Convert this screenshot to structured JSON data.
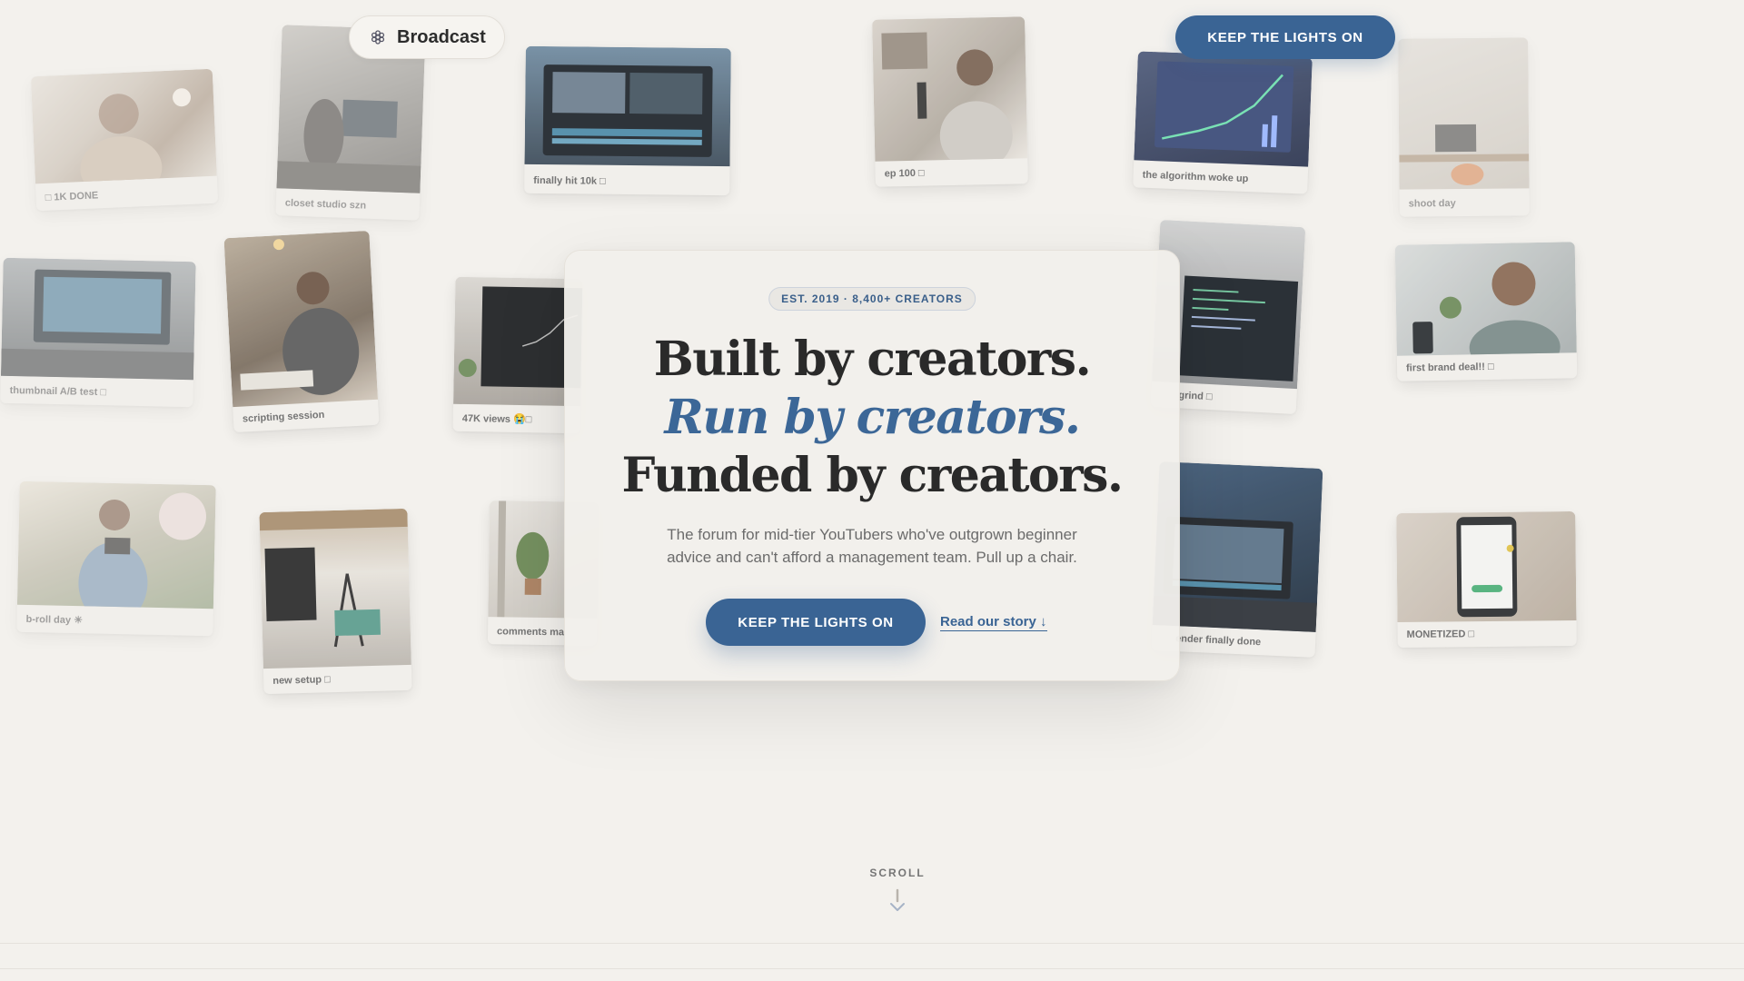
{
  "brand": {
    "name": "Broadcast",
    "logo_icon": "hex-flower-icon"
  },
  "header": {
    "cta_label": "KEEP THE LIGHTS ON"
  },
  "cards": [
    {
      "caption": "□ 1K DONE"
    },
    {
      "caption": "closet studio szn"
    },
    {
      "caption": "finally hit 10k □"
    },
    {
      "caption": "ep 100 □"
    },
    {
      "caption": "the algorithm woke up"
    },
    {
      "caption": "shoot day"
    },
    {
      "caption": "thumbnail A/B test □"
    },
    {
      "caption": "scripting session"
    },
    {
      "caption": "47K views 😭□"
    },
    {
      "caption": "grind □"
    },
    {
      "caption": "first brand deal!! □"
    },
    {
      "caption": "b-roll day ☀"
    },
    {
      "caption": "new setup □"
    },
    {
      "caption": "comments ma"
    },
    {
      "caption": "ender finally done"
    },
    {
      "caption": "MONETIZED □"
    }
  ],
  "hero": {
    "badge": "EST. 2019 · 8,400+ CREATORS",
    "headline_part1": "Built by creators.",
    "headline_accent": "Run by creators.",
    "headline_part2": "Funded by creators.",
    "subtext": "The forum for mid-tier YouTubers who've outgrown beginner advice and can't afford a management team. Pull up a chair.",
    "cta_label": "KEEP THE LIGHTS ON",
    "link_label": "Read our story ↓"
  },
  "scroll": {
    "label": "SCROLL",
    "icon": "arrow-down-icon"
  },
  "colors": {
    "accent": "#3a6494",
    "background": "#f3f1ed",
    "text": "#2a2a2a"
  }
}
